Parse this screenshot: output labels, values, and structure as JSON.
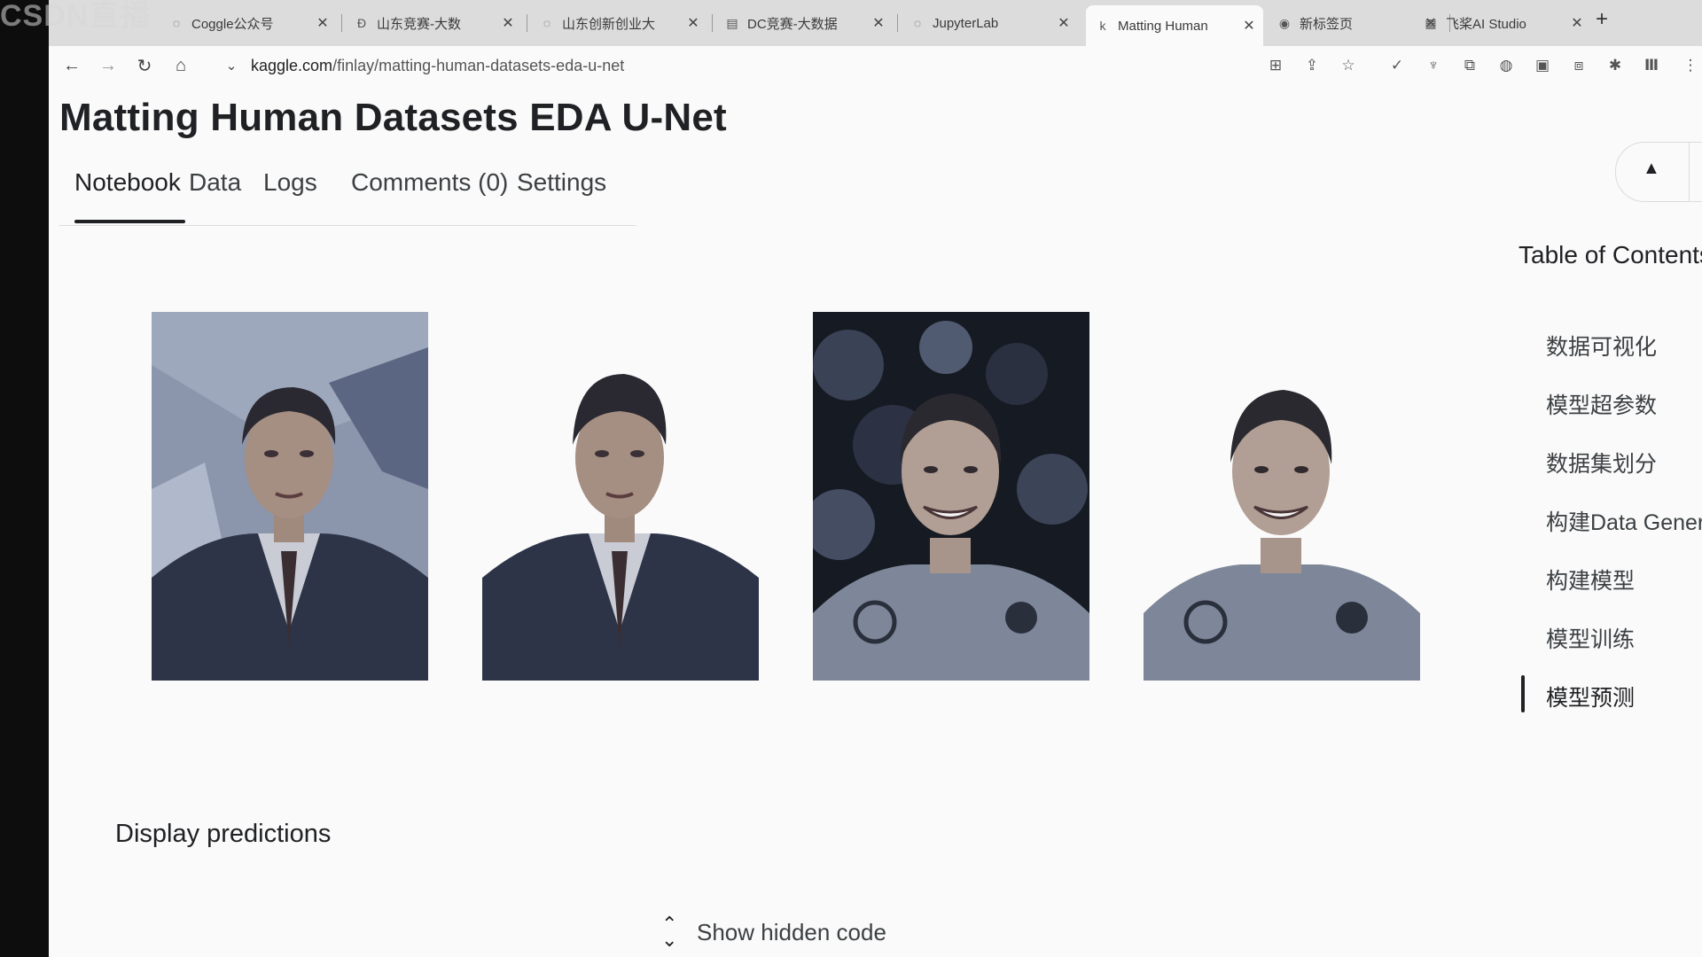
{
  "watermark": "CSDN直播",
  "tabs": [
    {
      "title": "Coggle公众号",
      "icon": "coggle-icon"
    },
    {
      "title": "山东竞赛-大数",
      "icon": "dc-icon"
    },
    {
      "title": "山东创新创业大",
      "icon": "loading-icon"
    },
    {
      "title": "DC竞赛-大数据",
      "icon": "dc-icon"
    },
    {
      "title": "JupyterLab",
      "icon": "loading-icon"
    },
    {
      "title": "Matting Human",
      "icon": "kaggle-k-icon"
    },
    {
      "title": "新标签页",
      "icon": "chrome-icon"
    },
    {
      "title": "飞桨AI Studio",
      "icon": "paddle-icon"
    }
  ],
  "address": {
    "host": "kaggle.com",
    "path": "/finlay/matting-human-datasets-eda-u-net"
  },
  "page": {
    "title": "Matting Human Datasets EDA U-Net",
    "tabs": [
      "Notebook",
      "Data",
      "Logs",
      "Comments (0)",
      "Settings"
    ],
    "active_tab": "Notebook",
    "scroll_count": "0"
  },
  "toc": {
    "title": "Table of Contents",
    "items": [
      "数据可视化",
      "模型超参数",
      "数据集划分",
      "构建Data Generator",
      "构建模型",
      "模型训练",
      "模型预测"
    ],
    "active": "模型预测"
  },
  "cell": {
    "section_heading": "Display predictions",
    "show_code_label": "Show hidden code"
  },
  "colors": {
    "accent": "#202124",
    "background": "#fafafa",
    "tabstrip": "#dcdcdc"
  }
}
